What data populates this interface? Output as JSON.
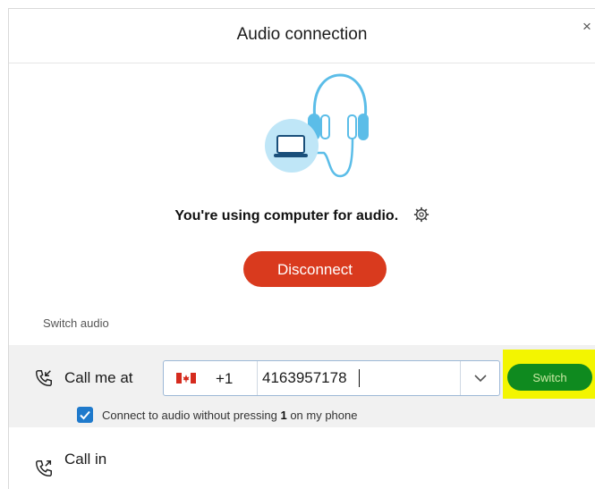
{
  "dialog": {
    "title": "Audio connection",
    "close_label": "×"
  },
  "status": {
    "text": "You're using computer for audio.",
    "icons": {
      "illustration": "laptop-headphones-illustration",
      "settings": "gear-icon"
    }
  },
  "actions": {
    "disconnect_label": "Disconnect"
  },
  "switch_audio": {
    "section_label": "Switch audio",
    "call_me": {
      "label": "Call me at",
      "country_flag": "canada-flag",
      "country_code": "+1",
      "phone_value": "4163957178",
      "switch_label": "Switch",
      "switch_highlight_color": "#f3f500",
      "switch_button_color": "#0f8a1f"
    },
    "option": {
      "checked": true,
      "label_prefix": "Connect to audio without pressing ",
      "label_key": "1",
      "label_suffix": " on my phone"
    },
    "call_in": {
      "label": "Call in"
    }
  },
  "colors": {
    "accent_blue": "#1f7acc",
    "disconnect_red": "#d93a1e",
    "illustration_blue": "#5bbde8"
  }
}
